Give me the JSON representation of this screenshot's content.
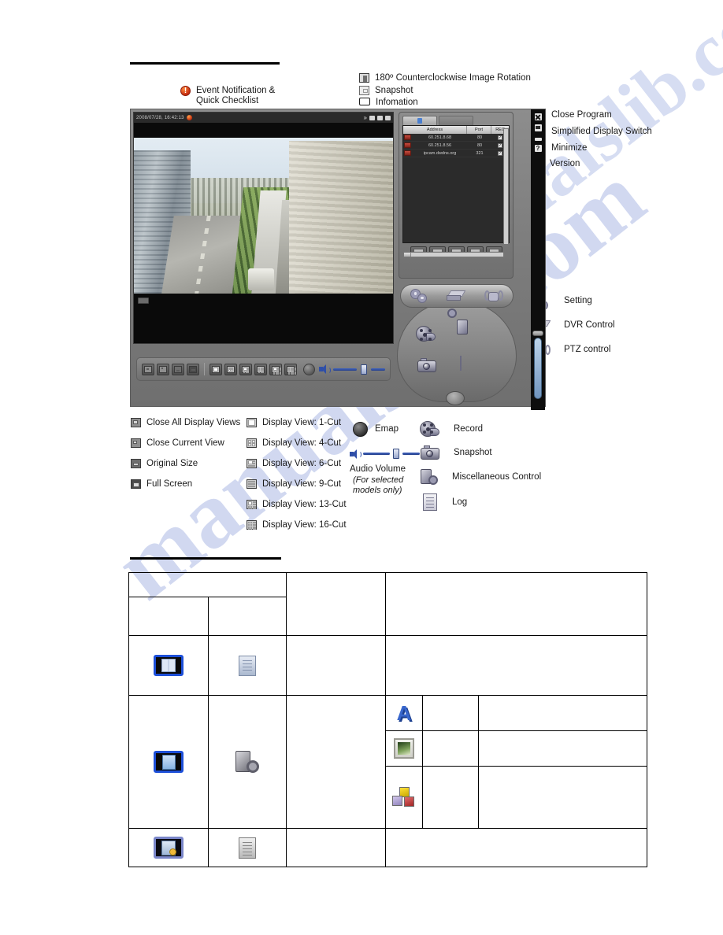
{
  "watermark": {
    "text": "manualslib.com"
  },
  "legend_top": {
    "event_notification": "Event Notification &\nQuick Checklist",
    "items": [
      {
        "icon": "rotate-icon",
        "label": "180º Counterclockwise Image Rotation"
      },
      {
        "icon": "snapshot-icon",
        "label": "Snapshot"
      },
      {
        "icon": "information-icon",
        "label": "Infomation"
      }
    ]
  },
  "legend_window": {
    "items": [
      {
        "icon": "close-program-icon",
        "label": "Close Program"
      },
      {
        "icon": "simplified-display-switch-icon",
        "label": "Simplified Display Switch"
      },
      {
        "icon": "minimize-icon",
        "label": "Minimize"
      },
      {
        "icon": "version-icon",
        "label": "Version"
      }
    ]
  },
  "legend_controls": {
    "items": [
      {
        "icon": "setting-gear-icon",
        "label": "Setting"
      },
      {
        "icon": "dvr-control-icon",
        "label": "DVR Control"
      },
      {
        "icon": "ptz-control-icon",
        "label": "PTZ control"
      }
    ]
  },
  "legend_views_left": {
    "items": [
      {
        "icon": "close-all-display-views-icon",
        "label": "Close All Display Views"
      },
      {
        "icon": "close-current-view-icon",
        "label": "Close Current View"
      },
      {
        "icon": "original-size-icon",
        "label": "Original Size"
      },
      {
        "icon": "full-screen-icon",
        "label": "Full Screen"
      }
    ]
  },
  "legend_views_mid": {
    "items": [
      {
        "icon": "display-view-1-cut-icon",
        "label": "Display View: 1-Cut",
        "cut": 1
      },
      {
        "icon": "display-view-4-cut-icon",
        "label": "Display View: 4-Cut",
        "cut": 4
      },
      {
        "icon": "display-view-6-cut-icon",
        "label": "Display View: 6-Cut",
        "cut": 6
      },
      {
        "icon": "display-view-9-cut-icon",
        "label": "Display View: 9-Cut",
        "cut": 9
      },
      {
        "icon": "display-view-13-cut-icon",
        "label": "Display View: 13-Cut",
        "cut": 13
      },
      {
        "icon": "display-view-16-cut-icon",
        "label": "Display View: 16-Cut",
        "cut": 16
      }
    ]
  },
  "legend_right": {
    "emap": "Emap",
    "audio_volume": "Audio Volume",
    "audio_note": "(For selected\nmodels only)",
    "items": [
      {
        "icon": "record-icon",
        "label": "Record"
      },
      {
        "icon": "snapshot-camera-icon",
        "label": "Snapshot"
      },
      {
        "icon": "miscellaneous-control-icon",
        "label": "Miscellaneous Control"
      },
      {
        "icon": "log-icon",
        "label": "Log"
      }
    ]
  },
  "app": {
    "video": {
      "timestamp": "2008/07/28, 16:42:13",
      "titlebar_icons": [
        "chevron-double-right-icon",
        "lock-icon",
        "snapshot-icon",
        "information-icon"
      ],
      "badge": "REC"
    },
    "server_list": {
      "columns": [
        "Address",
        "Port",
        "REC"
      ],
      "rows": [
        {
          "address": "60.251.8.68",
          "port": "80",
          "rec": "✓"
        },
        {
          "address": "60.251.8.56",
          "port": "80",
          "rec": "✓"
        },
        {
          "address": "ipcam.dwdns.org",
          "port": "321",
          "rec": "✓"
        }
      ]
    },
    "cluster": {
      "pill": [
        "setting-gear-icon",
        "dvr-control-icon",
        "ptz-control-icon"
      ],
      "buttons": [
        "record-icon",
        "miscellaneous-control-icon",
        "snapshot-camera-icon",
        "log-icon"
      ]
    },
    "strip_buttons": [
      "close-program-icon",
      "simplified-display-switch-icon",
      "minimize-icon",
      "version-icon"
    ]
  },
  "spec_table": {
    "rows": [
      {
        "icons": [],
        "type": "header-a"
      },
      {
        "icons": [],
        "type": "header-b"
      },
      {
        "icons": [
          "address-book-icon",
          "document-icon"
        ],
        "type": "body"
      },
      {
        "icons": [
          "blue-list-icon",
          "camera-settings-icon"
        ],
        "subicons": [
          "font-a-icon",
          "image-icon",
          "cubes-icon"
        ],
        "type": "body-sub"
      },
      {
        "icons": [
          "notepad-icon",
          "log-document-icon"
        ],
        "type": "body"
      }
    ]
  }
}
